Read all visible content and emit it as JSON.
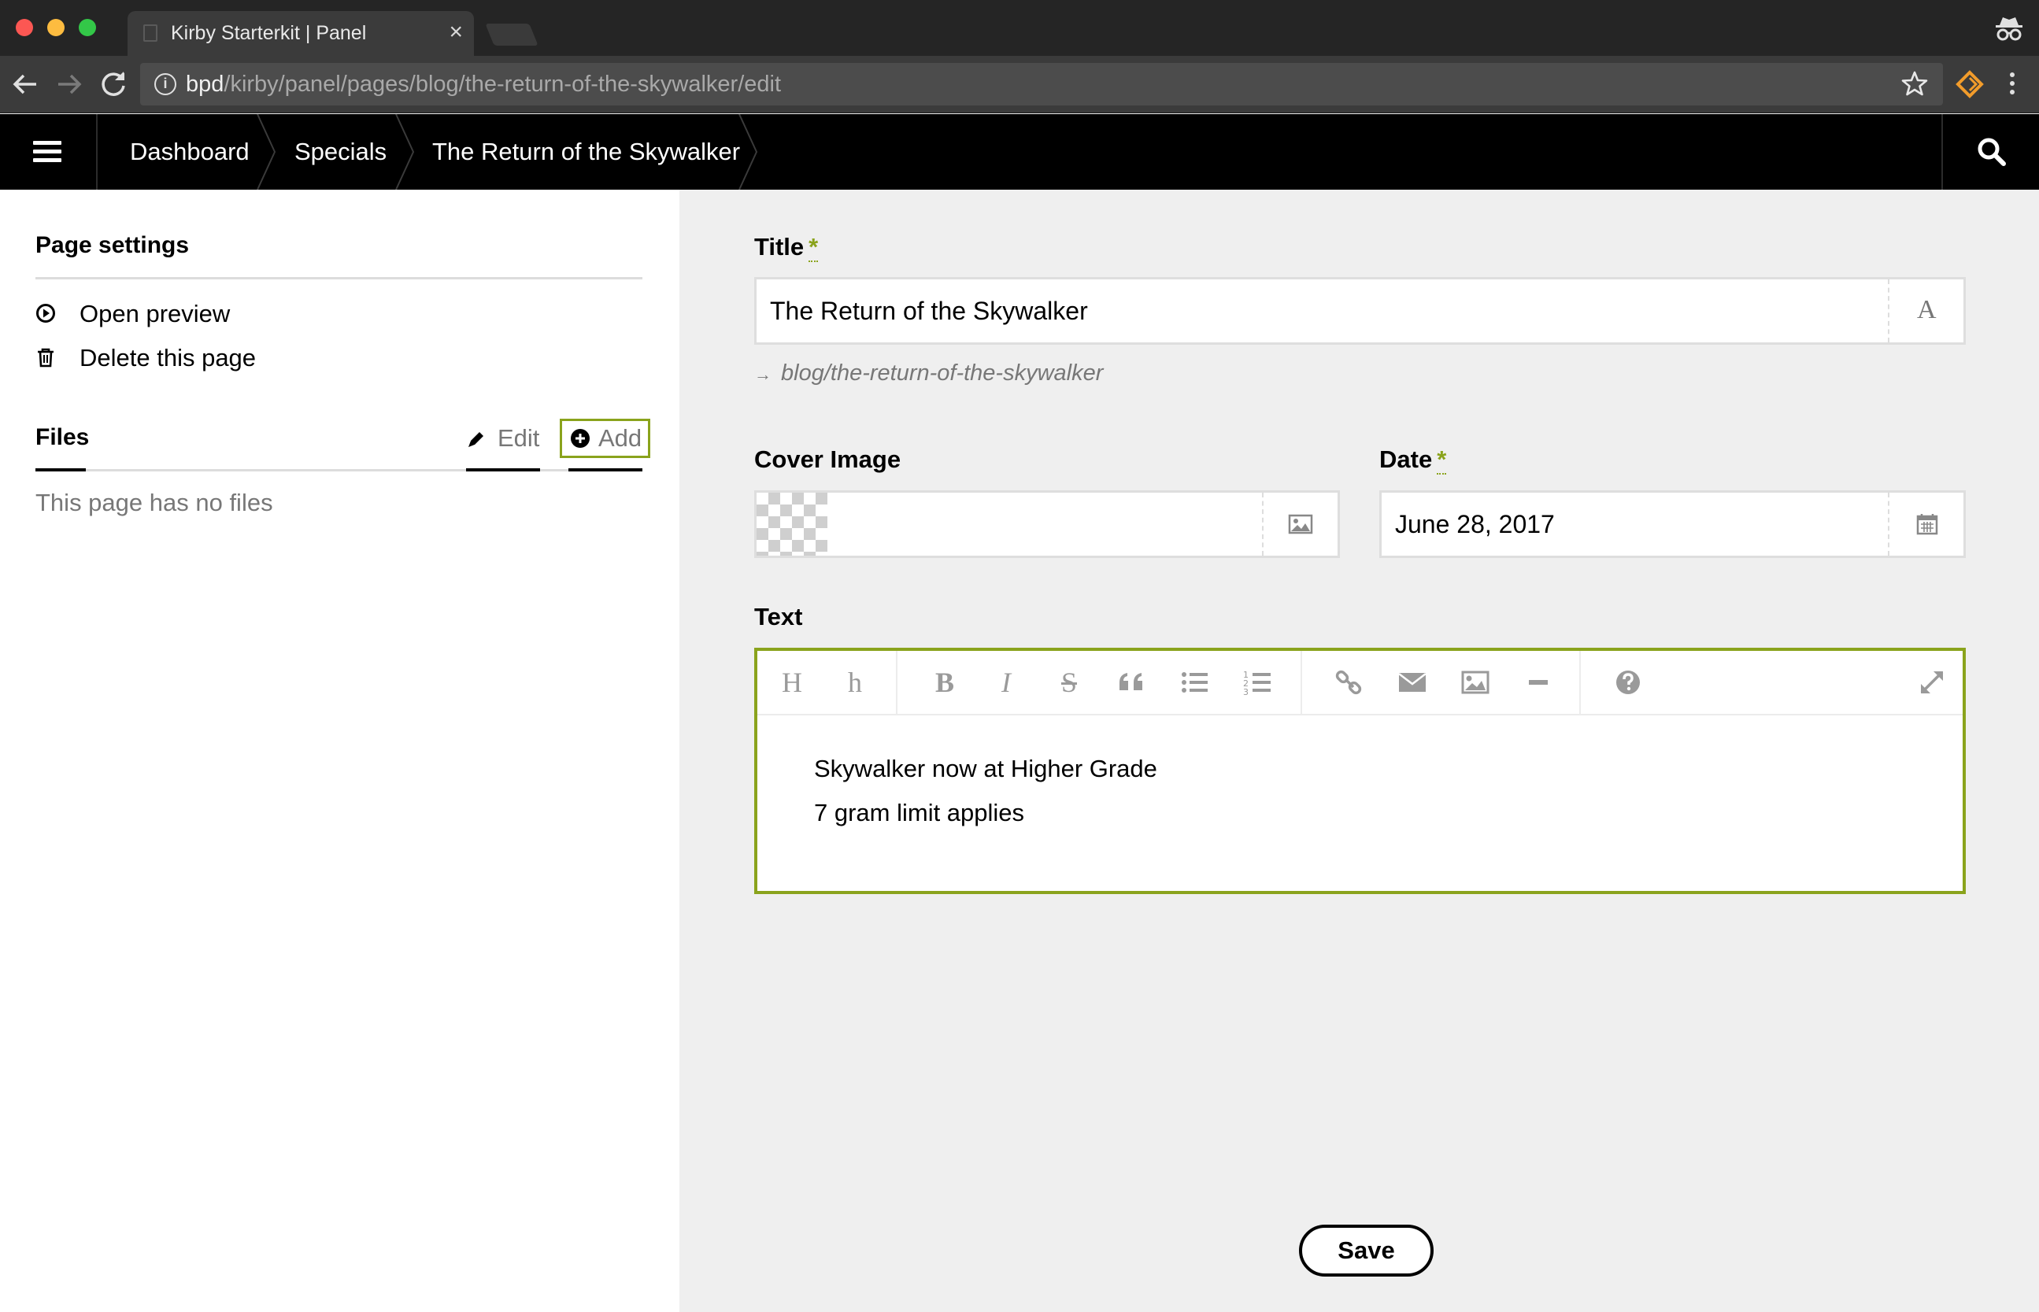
{
  "browser": {
    "tab_title": "Kirby Starterkit | Panel",
    "tab_close": "×",
    "url_host": "bpd",
    "url_path": "/kirby/panel/pages/blog/the-return-of-the-skywalker/edit",
    "traffic_colors": [
      "#fc5753",
      "#fdbc40",
      "#33c748"
    ],
    "extension_color": "#f29c2b"
  },
  "topbar": {
    "breadcrumbs": [
      "Dashboard",
      "Specials",
      "The Return of the Skywalker"
    ],
    "menu_icon": "hamburger-icon",
    "search_icon": "search-icon"
  },
  "sidebar": {
    "settings_heading": "Page settings",
    "open_preview": "Open preview",
    "delete_page": "Delete this page",
    "files_heading": "Files",
    "files_edit": "Edit",
    "files_add": "Add",
    "no_files": "This page has no files"
  },
  "form": {
    "title_label": "Title",
    "required_mark": "*",
    "title_value": "The Return of the Skywalker",
    "title_addon": "A",
    "slug_arrow": "→",
    "slug": "blog/the-return-of-the-skywalker",
    "cover_label": "Cover Image",
    "date_label": "Date",
    "date_value": "June 28, 2017",
    "text_label": "Text",
    "toolbar_buttons": [
      "H",
      "h",
      "B",
      "I",
      "S",
      "quote-icon",
      "bullet-list-icon",
      "numbered-list-icon",
      "link-icon",
      "email-icon",
      "image-icon",
      "rule-icon",
      "help-icon",
      "fullscreen-icon"
    ],
    "text_lines": [
      "Skywalker now at Higher Grade",
      "7 gram limit applies"
    ],
    "save_label": "Save"
  },
  "colors": {
    "accent": "#8aa31c",
    "topbar": "#000000",
    "content_bg": "#efefef"
  }
}
